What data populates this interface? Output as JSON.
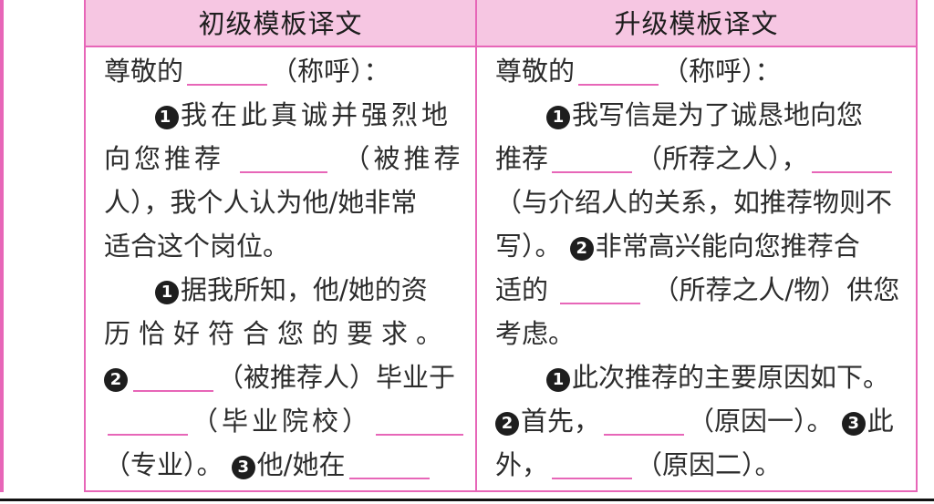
{
  "headers": {
    "left": "初级模板译文",
    "right": "升级模板译文"
  },
  "left": {
    "l1a": "尊敬的",
    "l1b": "（称呼）：",
    "l2n": "1",
    "l2t": "我在此真诚并强烈地",
    "l3a": "向您推荐",
    "l3b": "（被推荐",
    "l4": "人），我个人认为他/她非常",
    "l5": "适合这个岗位。",
    "l6n": "1",
    "l6t": "据我所知，他/她的资",
    "l7": "历恰好符合您的要求。",
    "l8n": "2",
    "l8t": "（被推荐人）毕业于",
    "l9": "（毕业院校）",
    "l10a": "（专业）。",
    "l10n": "3",
    "l10b": "他/她在"
  },
  "right": {
    "r1a": "尊敬的",
    "r1b": "（称呼）：",
    "r2n": "1",
    "r2t": "我写信是为了诚恳地向您",
    "r3a": "推荐",
    "r3b": "（所荐之人），",
    "r4": "（与介绍人的关系，如推荐物则不",
    "r5a": "写）。",
    "r5n": "2",
    "r5t": "非常高兴能向您推荐合",
    "r6a": "适的",
    "r6b": "（所荐之人/物）供您",
    "r7": "考虑。",
    "r8n": "1",
    "r8t": "此次推荐的主要原因如下。",
    "r9n": "2",
    "r9a": "首先，",
    "r9b": "（原因一）。",
    "r9n2": "3",
    "r9c": "此",
    "r10a": "外，",
    "r10b": "（原因二）。"
  },
  "colors": {
    "border": "#e766b8",
    "header_bg": "#f6c6e2"
  }
}
